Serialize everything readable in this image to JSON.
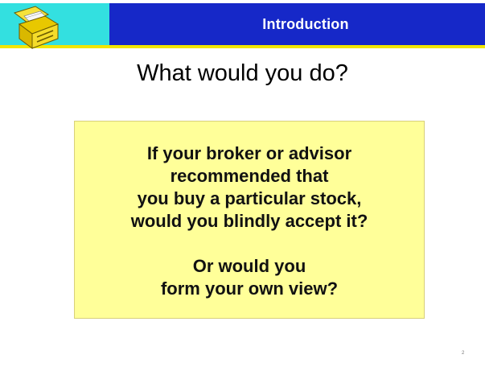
{
  "header": {
    "title": "Introduction",
    "logo_icon": "briefcase-icon",
    "colors": {
      "left_block": "#33e0e0",
      "bar": "#1628c8",
      "underline": "#f2e600"
    }
  },
  "main": {
    "question": "What would you do?",
    "box": {
      "paragraph1": "If your broker or advisor\nrecommended that\nyou buy a particular stock,\nwould you blindly accept it?",
      "paragraph2": "Or would you\nform your own view?",
      "background": "#ffff99"
    }
  },
  "footer": {
    "page_number": "2"
  }
}
